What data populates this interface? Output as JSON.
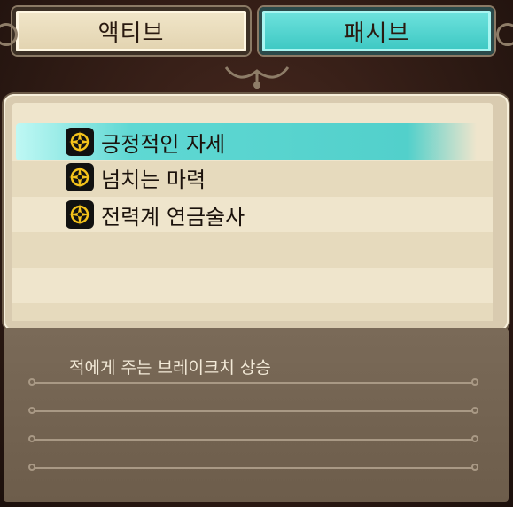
{
  "tabs": [
    {
      "label": "액티브",
      "active": false
    },
    {
      "label": "패시브",
      "active": true
    }
  ],
  "skills": [
    {
      "label": "긍정적인 자세",
      "icon": "compass-rose-icon",
      "selected": true
    },
    {
      "label": "넘치는 마력",
      "icon": "compass-rose-icon",
      "selected": false
    },
    {
      "label": "전력계 연금술사",
      "icon": "compass-rose-icon",
      "selected": false
    }
  ],
  "description": {
    "lines": [
      "적에게 주는 브레이크치 상승",
      "",
      "",
      ""
    ]
  },
  "colors": {
    "accent": "#52d0cb",
    "panel": "#efe5cc",
    "desc_bg": "#6d5d4b"
  }
}
